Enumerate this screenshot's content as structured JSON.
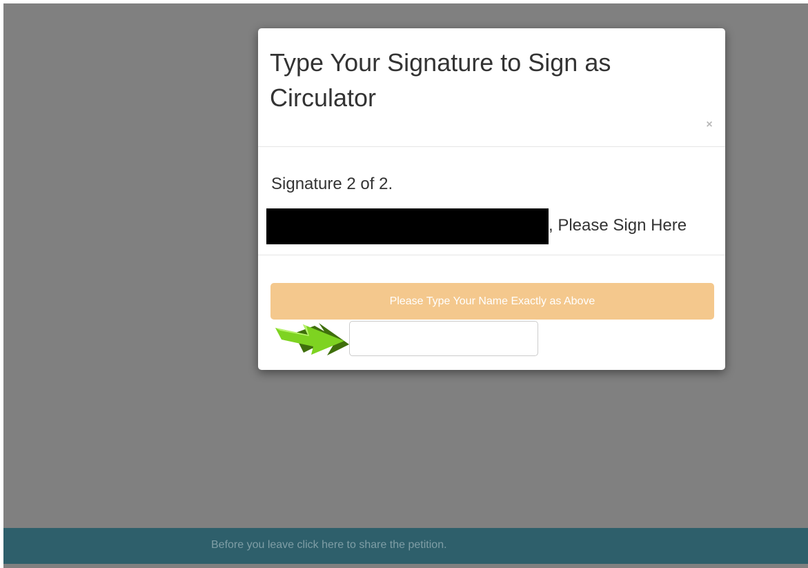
{
  "modal": {
    "title": "Type Your Signature to Sign as Circulator",
    "close_symbol": "×",
    "signature_count": "Signature 2 of 2.",
    "sign_prompt": ", Please Sign Here",
    "instruction": "Please Type Your Name Exactly as Above",
    "name_input_value": "",
    "arrow_icon": "green-arrow-right-icon"
  },
  "footer": {
    "share_text": "Before you leave click here to share the petition."
  },
  "colors": {
    "backdrop": "#808080",
    "instruction_banner": "#f4c88d",
    "arrow_green": "#7ed321",
    "share_bar": "#2e5f6b"
  }
}
